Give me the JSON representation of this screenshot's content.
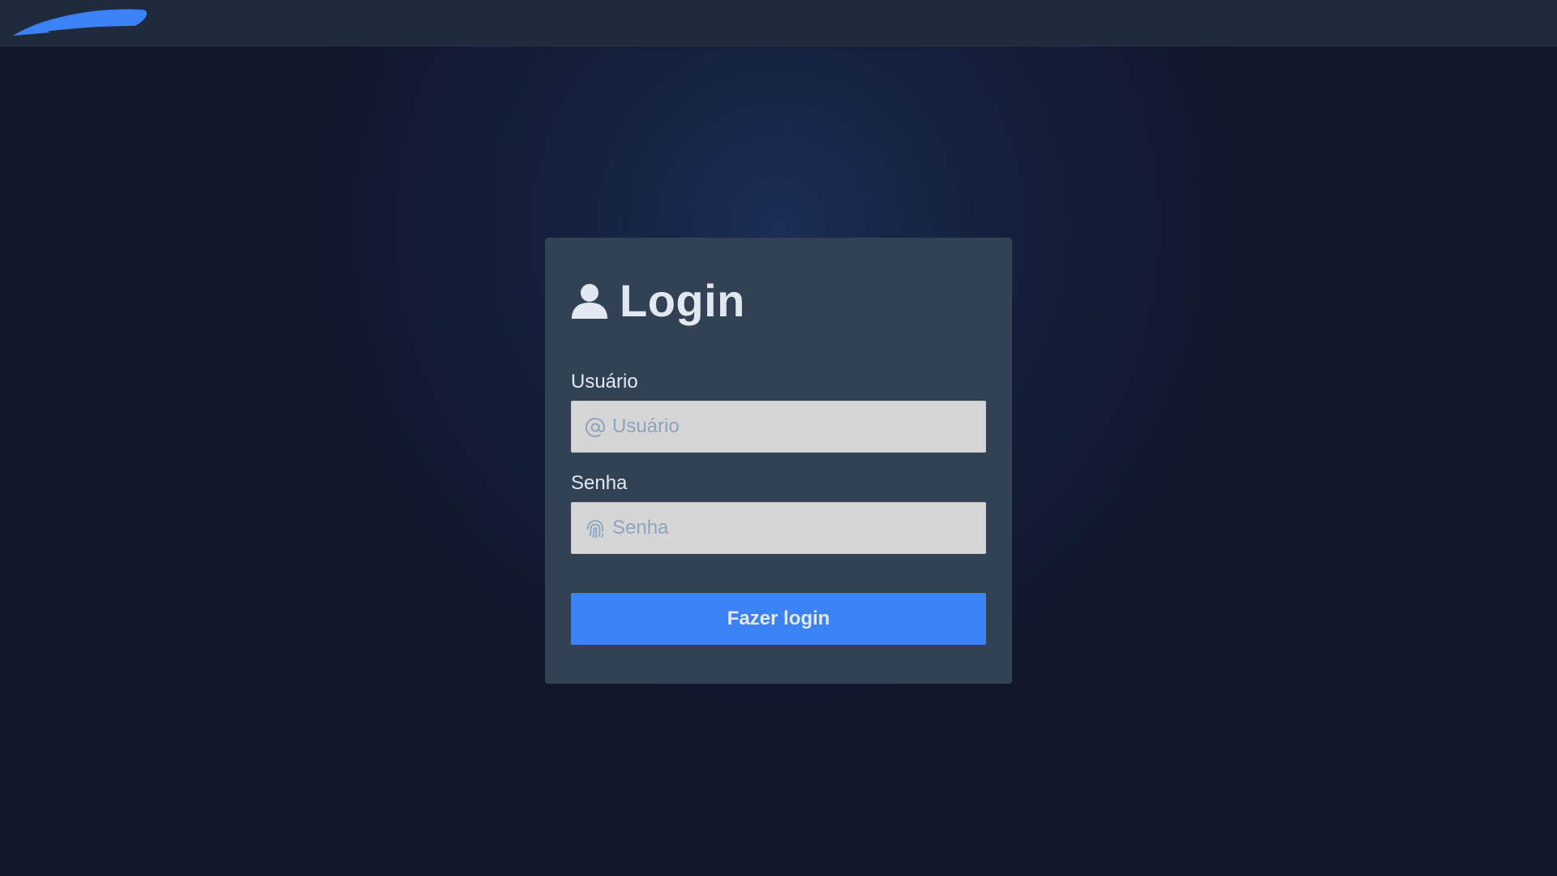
{
  "header": {
    "logo_icon": "swoosh-logo-icon",
    "logo_color": "#3b82f6"
  },
  "login_card": {
    "title": "Login",
    "title_icon": "user-icon",
    "username": {
      "label": "Usuário",
      "placeholder": "Usuário",
      "value": "",
      "icon": "at-sign-icon"
    },
    "password": {
      "label": "Senha",
      "placeholder": "Senha",
      "value": "",
      "icon": "fingerprint-icon"
    },
    "submit_label": "Fazer login"
  },
  "colors": {
    "background": "#0f172a",
    "topbar": "#1f2a3c",
    "card": "#334155",
    "input": "#d6d6d6",
    "primary": "#3b82f6",
    "text": "#e2e8f0",
    "placeholder": "#8fa3bd"
  }
}
